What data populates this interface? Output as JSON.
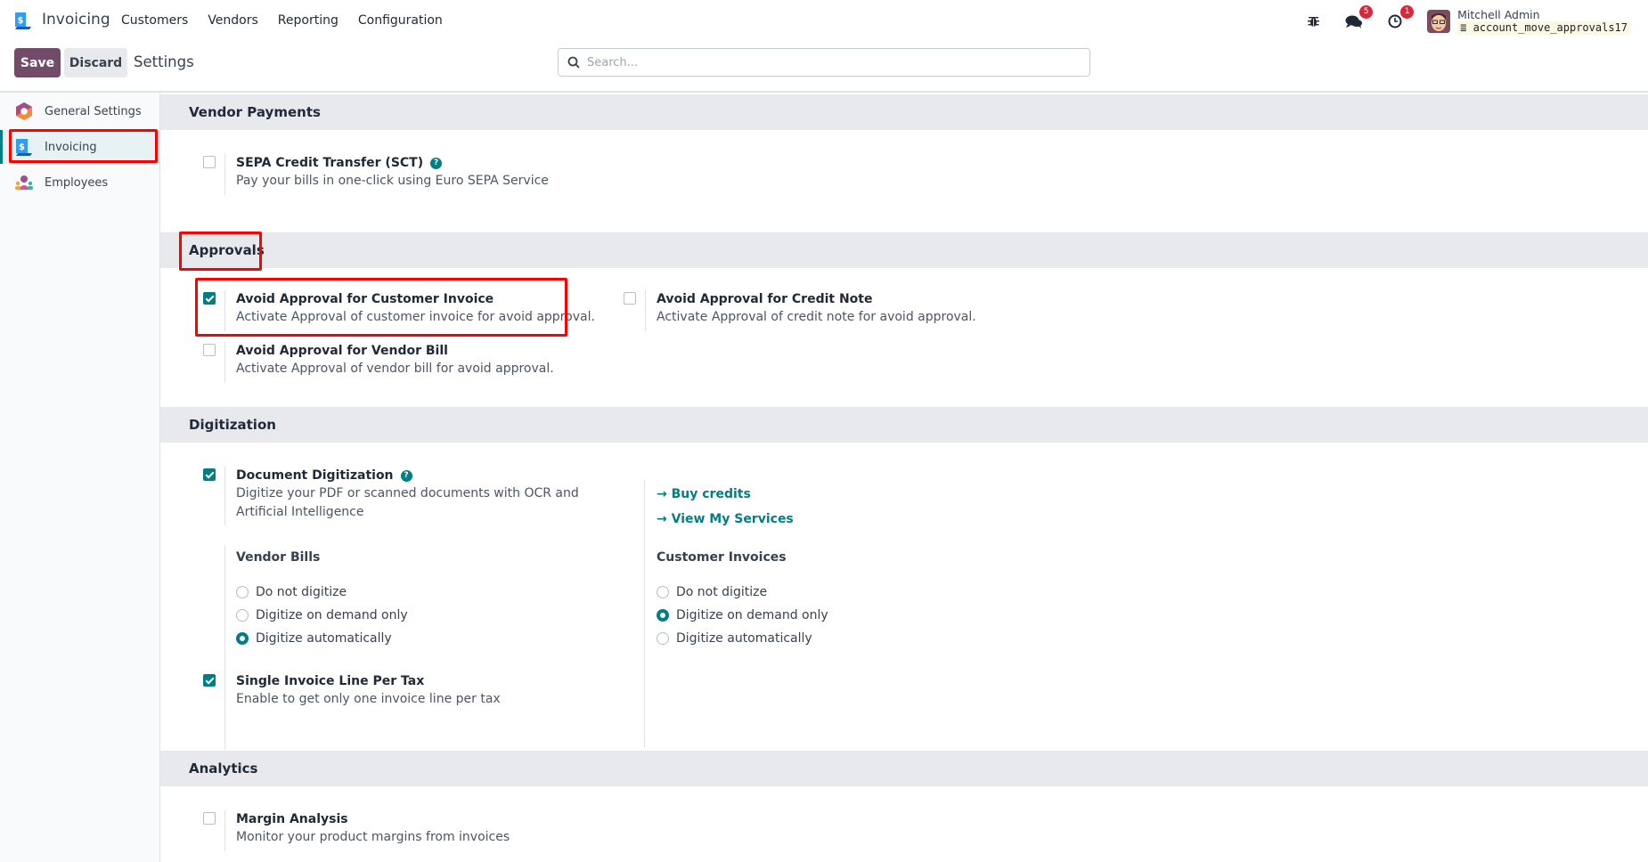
{
  "navbar": {
    "app_name": "Invoicing",
    "menu": [
      "Customers",
      "Vendors",
      "Reporting",
      "Configuration"
    ],
    "icons": {
      "debug": "bug-icon",
      "messages": "chat-icon",
      "activities": "clock-icon"
    },
    "messages_count": "5",
    "activities_count": "1",
    "user_name": "Mitchell Admin",
    "database": "account_move_approvals17"
  },
  "control": {
    "save_label": "Save",
    "discard_label": "Discard",
    "title": "Settings",
    "search_placeholder": "Search..."
  },
  "sidebar": {
    "items": [
      {
        "label": "General Settings",
        "icon": "general-settings-icon",
        "active": false
      },
      {
        "label": "Invoicing",
        "icon": "invoicing-icon",
        "active": true
      },
      {
        "label": "Employees",
        "icon": "employees-icon",
        "active": false
      }
    ]
  },
  "sections": {
    "vendor_payments": {
      "title": "Vendor Payments",
      "settings": [
        {
          "title": "SEPA Credit Transfer (SCT)",
          "desc": "Pay your bills in one-click using Euro SEPA Service",
          "checked": false,
          "help": true
        }
      ]
    },
    "approvals": {
      "title": "Approvals",
      "settings": [
        {
          "title": "Avoid Approval for Customer Invoice",
          "desc": "Activate Approval of customer invoice for avoid approval.",
          "checked": true
        },
        {
          "title": "Avoid Approval for Credit Note",
          "desc": "Activate Approval of credit note for avoid approval.",
          "checked": false
        },
        {
          "title": "Avoid Approval for Vendor Bill",
          "desc": "Activate Approval of vendor bill for avoid approval.",
          "checked": false
        }
      ]
    },
    "digitization": {
      "title": "Digitization",
      "document": {
        "title": "Document Digitization",
        "desc_line1": "Digitize your PDF or scanned documents with OCR and",
        "desc_line2": "Artificial Intelligence",
        "checked": true,
        "help": true
      },
      "links": [
        "Buy credits",
        "View My Services"
      ],
      "vendor_bills": {
        "label": "Vendor Bills",
        "options": [
          "Do not digitize",
          "Digitize on demand only",
          "Digitize automatically"
        ],
        "selected": "Digitize automatically"
      },
      "customer_invoices": {
        "label": "Customer Invoices",
        "options": [
          "Do not digitize",
          "Digitize on demand only",
          "Digitize automatically"
        ],
        "selected": "Digitize on demand only"
      },
      "single_line": {
        "title": "Single Invoice Line Per Tax",
        "desc": "Enable to get only one invoice line per tax",
        "checked": true
      }
    },
    "analytics": {
      "title": "Analytics",
      "settings": [
        {
          "title": "Margin Analysis",
          "desc": "Monitor your product margins from invoices",
          "checked": false
        }
      ]
    }
  },
  "colors": {
    "brand": "#714b67",
    "accent": "#017e84",
    "badge": "#d8283b",
    "annotation": "#ff0000"
  }
}
